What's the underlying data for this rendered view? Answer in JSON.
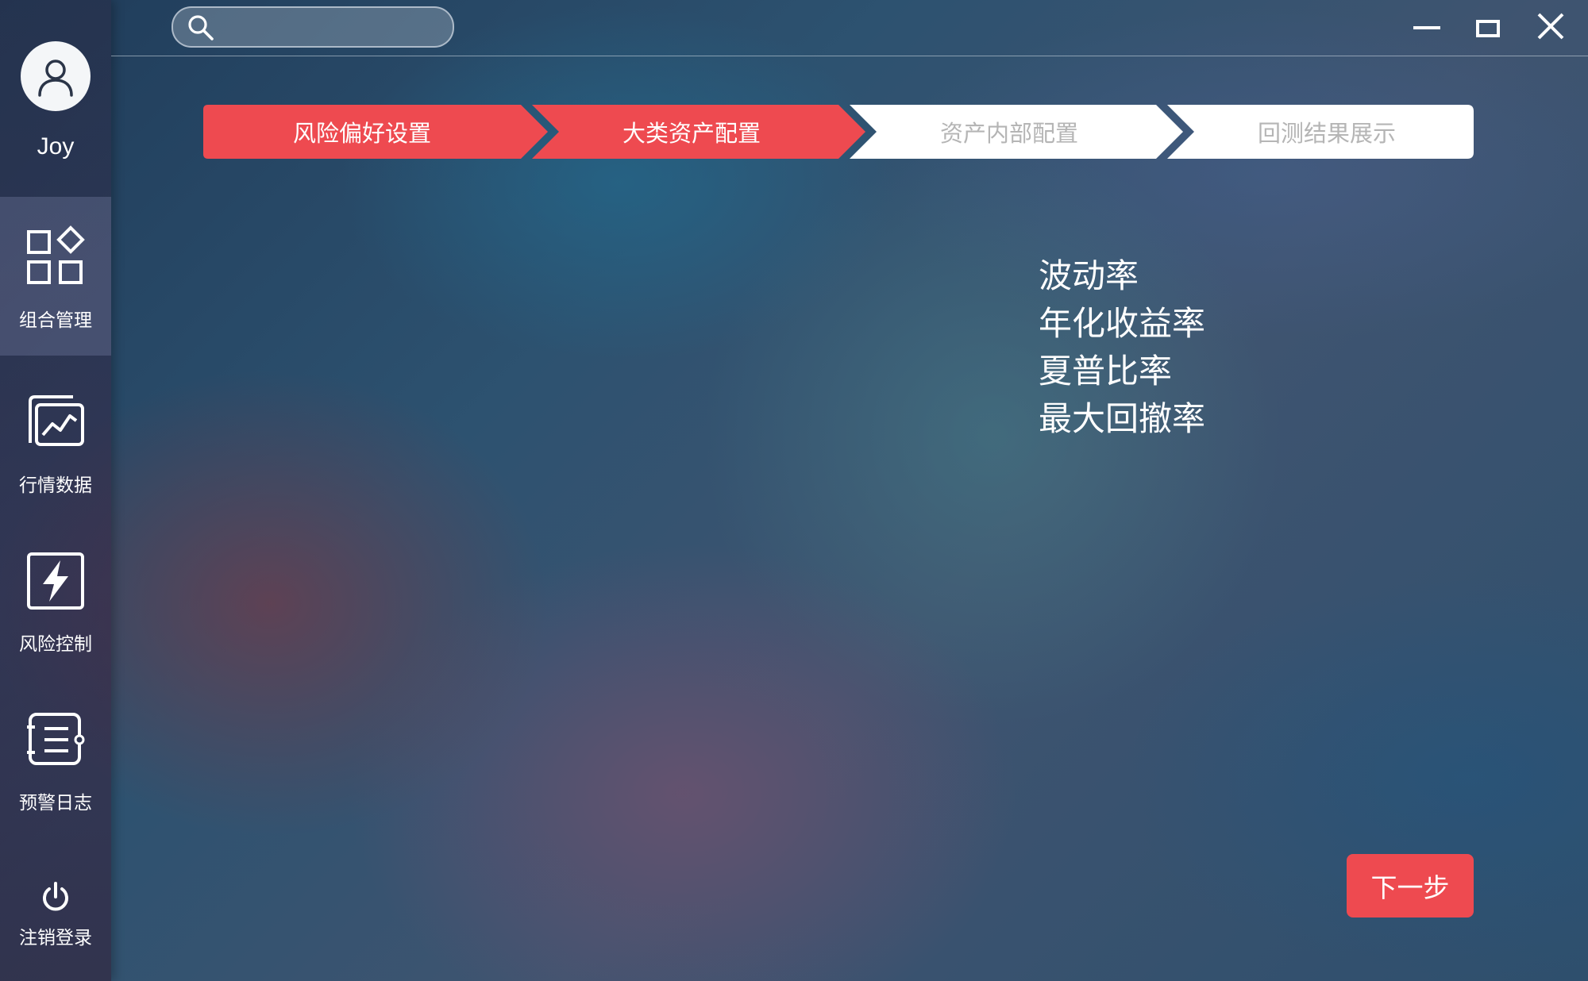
{
  "user": {
    "name": "Joy",
    "avatar_icon": "user-icon"
  },
  "sidebar": {
    "items": [
      {
        "label": "组合管理",
        "icon": "portfolio-icon",
        "active": true
      },
      {
        "label": "行情数据",
        "icon": "market-chart-icon",
        "active": false
      },
      {
        "label": "风险控制",
        "icon": "lightning-icon",
        "active": false
      },
      {
        "label": "预警日志",
        "icon": "log-list-icon",
        "active": false
      }
    ],
    "logout": {
      "label": "注销登录",
      "icon": "power-icon"
    }
  },
  "search": {
    "placeholder": "",
    "value": "",
    "icon": "search-icon"
  },
  "window_controls": {
    "minimize": "minimize-icon",
    "maximize": "maximize-icon",
    "close": "close-icon"
  },
  "steps": [
    {
      "label": "风险偏好设置",
      "state": "done"
    },
    {
      "label": "大类资产配置",
      "state": "current"
    },
    {
      "label": "资产内部配置",
      "state": "pending"
    },
    {
      "label": "回测结果展示",
      "state": "pending"
    }
  ],
  "metrics": [
    "波动率",
    "年化收益率",
    "夏普比率",
    "最大回撤率"
  ],
  "next_button": {
    "label": "下一步"
  },
  "colors": {
    "accent": "#ee4a50",
    "pending_step_bg": "#ffffff",
    "pending_step_text": "#b5b5b5",
    "text": "#ffffff"
  }
}
